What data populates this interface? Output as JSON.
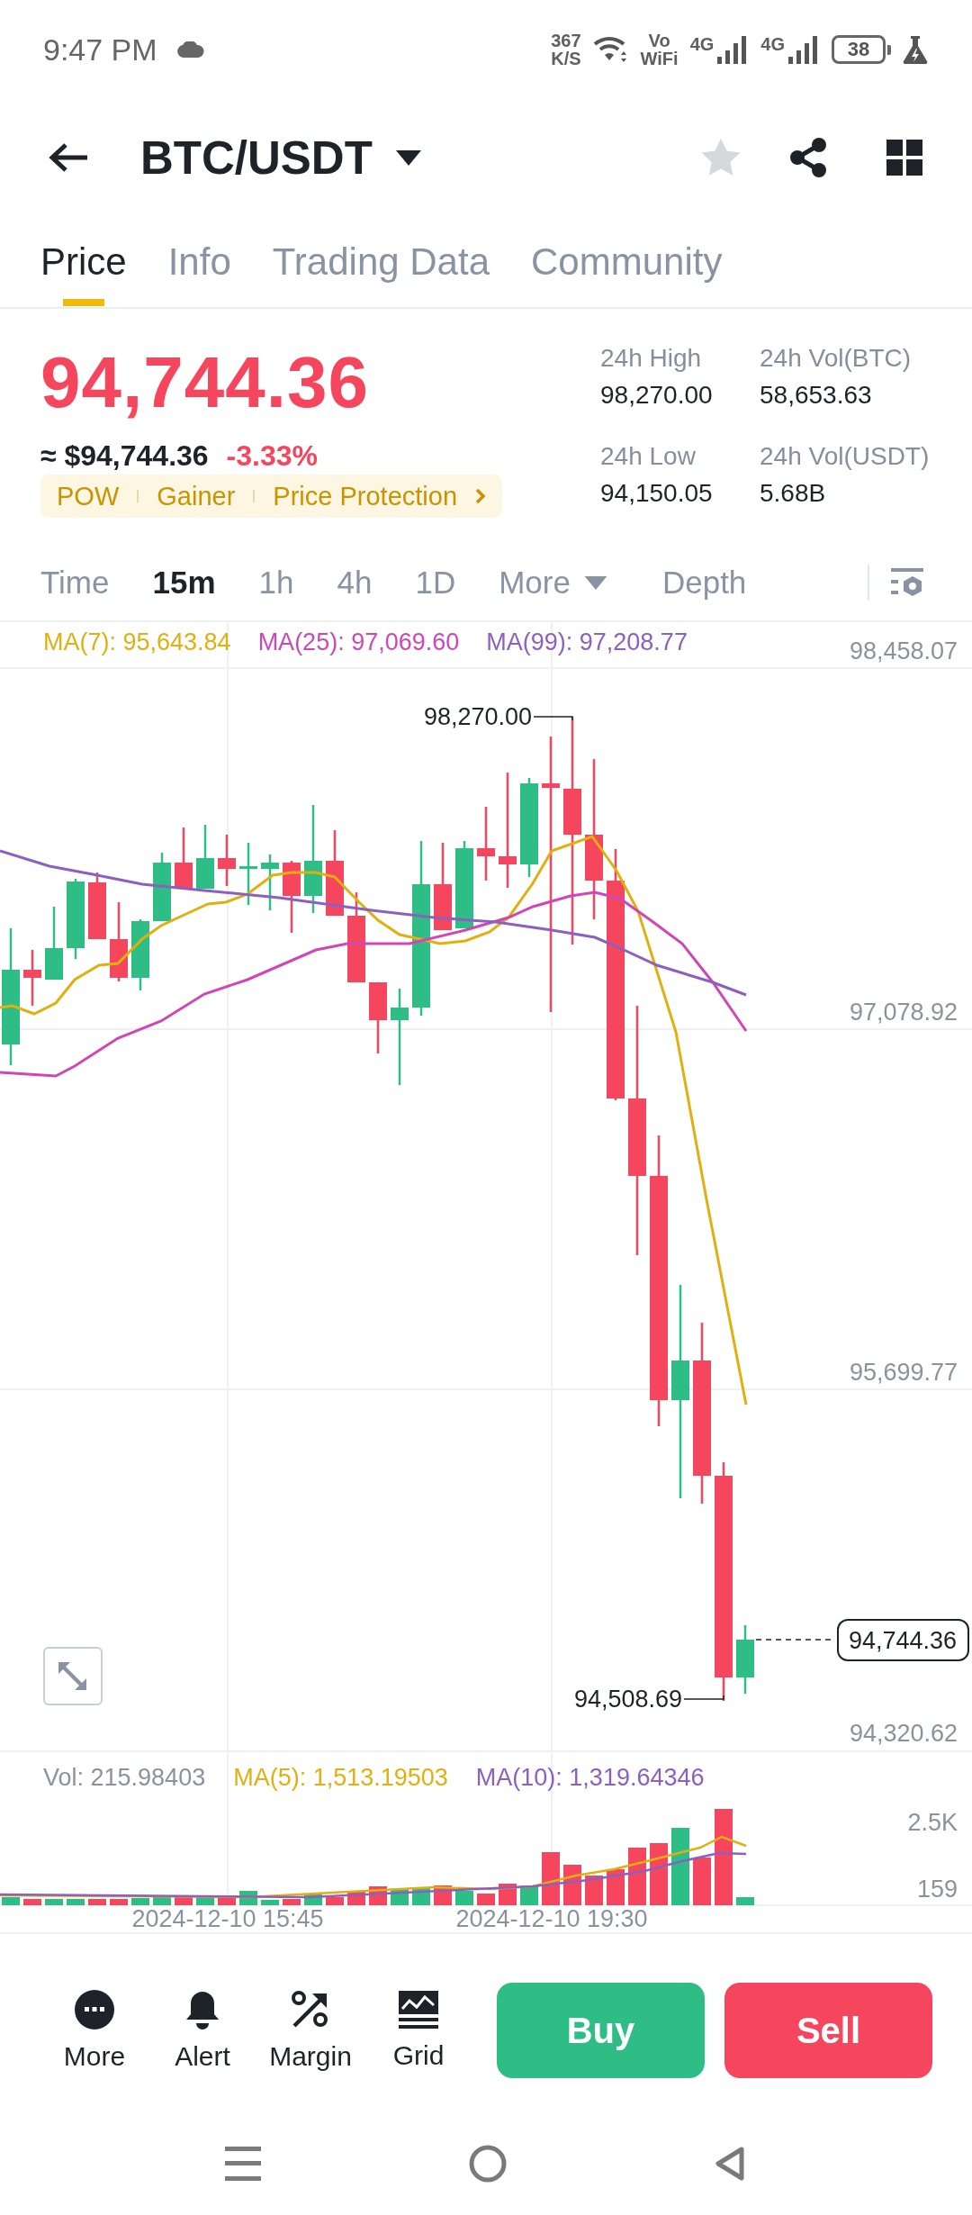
{
  "status_bar": {
    "time": "9:47 PM",
    "net_speed": "367",
    "net_unit": "K/S",
    "vowifi_top": "Vo",
    "vowifi_bottom": "WiFi",
    "networks": [
      "4G",
      "4G"
    ],
    "battery": "38"
  },
  "header": {
    "pair": "BTC/USDT",
    "favorite": false
  },
  "tabs": [
    {
      "label": "Price",
      "selected": true
    },
    {
      "label": "Info",
      "selected": false
    },
    {
      "label": "Trading Data",
      "selected": false
    },
    {
      "label": "Community",
      "selected": false
    }
  ],
  "ticker": {
    "last_price": "94,744.36",
    "fiat_price": "≈ $94,744.36",
    "change": "-3.33%",
    "tags": [
      "POW",
      "Gainer",
      "Price Protection"
    ],
    "stats": [
      {
        "label": "24h High",
        "value": "98,270.00"
      },
      {
        "label": "24h Vol(BTC)",
        "value": "58,653.63"
      },
      {
        "label": "24h Low",
        "value": "94,150.05"
      },
      {
        "label": "24h Vol(USDT)",
        "value": "5.68B"
      }
    ]
  },
  "intervals": [
    {
      "label": "Time",
      "kind": "option",
      "selected": false
    },
    {
      "label": "15m",
      "kind": "option",
      "selected": true
    },
    {
      "label": "1h",
      "kind": "option",
      "selected": false
    },
    {
      "label": "4h",
      "kind": "option",
      "selected": false
    },
    {
      "label": "1D",
      "kind": "option",
      "selected": false
    },
    {
      "label": "More",
      "kind": "dropdown",
      "selected": false
    },
    {
      "label": "Depth",
      "kind": "option",
      "selected": false
    }
  ],
  "chart": {
    "indicators": [
      {
        "label": "MA(7): 95,643.84",
        "color": "#e0b010"
      },
      {
        "label": "MA(25): 97,069.60",
        "color": "#d146b6"
      },
      {
        "label": "MA(99): 97,208.77",
        "color": "#8c5fc0"
      }
    ],
    "price_axis": [
      "98,458.07",
      "97,078.92",
      "95,699.77",
      "94,320.62"
    ],
    "high_label": "98,270.00",
    "low_label": "94,508.69",
    "last_price": "94,744.36"
  },
  "volume": {
    "current": "Vol: 215.98403",
    "indicators": [
      {
        "label": "MA(5): 1,513.19503",
        "color": "#e0b010"
      },
      {
        "label": "MA(10): 1,319.64346",
        "color": "#8c5fc0"
      }
    ],
    "axis": [
      "2.5K",
      "159"
    ],
    "time_axis": [
      "2024-12-10 15:45",
      "2024-12-10 19:30"
    ]
  },
  "actions": [
    {
      "label": "More"
    },
    {
      "label": "Alert"
    },
    {
      "label": "Margin"
    },
    {
      "label": "Grid"
    }
  ],
  "trade_buttons": [
    {
      "label": "Buy",
      "kind": "buy"
    },
    {
      "label": "Sell",
      "kind": "sell"
    }
  ]
}
